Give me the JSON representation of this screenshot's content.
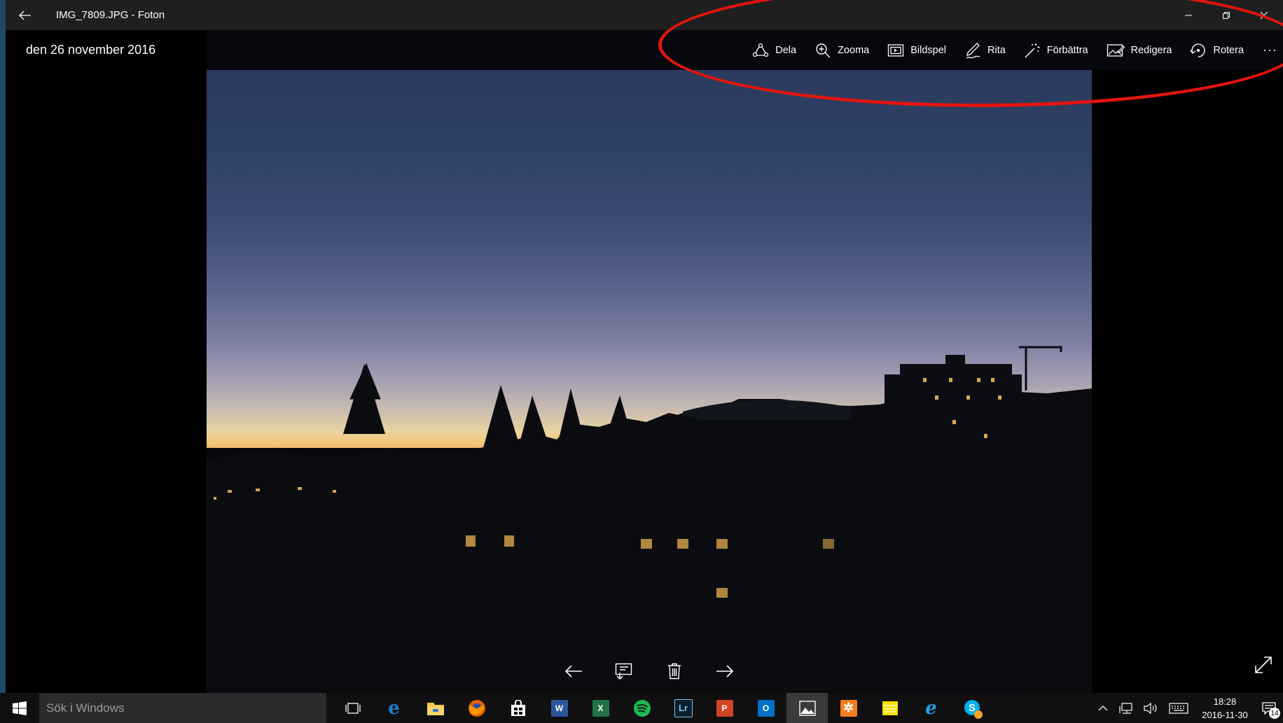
{
  "window": {
    "title": "IMG_7809.JPG - Foton"
  },
  "photo": {
    "date": "den 26 november 2016"
  },
  "toolbar": {
    "items": [
      {
        "label": "Dela",
        "icon": "share-icon"
      },
      {
        "label": "Zooma",
        "icon": "zoom-in-icon"
      },
      {
        "label": "Bildspel",
        "icon": "slideshow-icon"
      },
      {
        "label": "Rita",
        "icon": "draw-pen-icon"
      },
      {
        "label": "Förbättra",
        "icon": "enhance-wand-icon"
      },
      {
        "label": "Redigera",
        "icon": "edit-image-icon"
      },
      {
        "label": "Rotera",
        "icon": "rotate-icon"
      }
    ],
    "more": "···"
  },
  "taskbar": {
    "search_placeholder": "Sök i Windows",
    "apps": [
      "task-view",
      "edge",
      "file-explorer",
      "firefox",
      "store",
      "word",
      "excel",
      "spotify",
      "lightroom",
      "powerpoint",
      "outlook",
      "photos",
      "app-orange",
      "sticky-notes",
      "internet-explorer",
      "skype"
    ],
    "app_labels": {
      "lightroom": "Lr"
    },
    "clock_time": "18:28",
    "clock_date": "2016-11-30",
    "notification_count": "14"
  },
  "colors": {
    "callout": "#e3140f",
    "title_bar": "#1f1f1f",
    "taskbar": "#101010"
  }
}
